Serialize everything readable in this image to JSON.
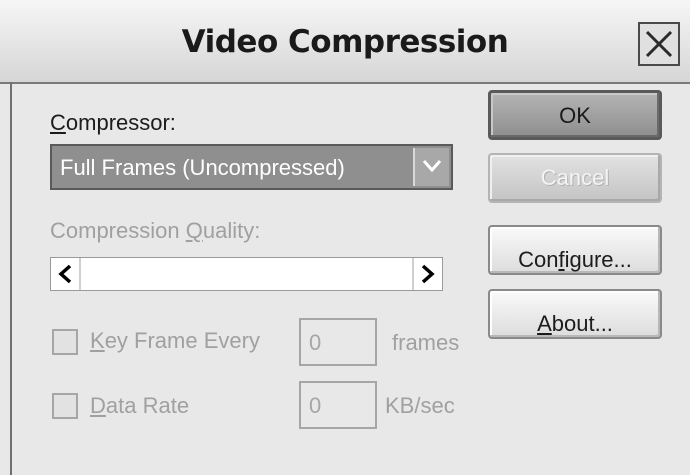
{
  "window": {
    "title": "Video Compression",
    "close_icon": "close-icon"
  },
  "compressor": {
    "label_underlined": "C",
    "label_rest": "ompressor:",
    "selected_value": "Full Frames (Uncompressed)",
    "arrow_icon": "chevron-down-icon"
  },
  "quality": {
    "label_pre": "Compression ",
    "label_underlined": "Q",
    "label_rest": "uality:",
    "left_icon": "chevron-left-icon",
    "right_icon": "chevron-right-icon"
  },
  "key_frame": {
    "label_underlined": "K",
    "label_rest": "ey Frame Every",
    "value": "0",
    "unit": "frames",
    "checked": false
  },
  "data_rate": {
    "label_underlined": "D",
    "label_rest": "ata Rate",
    "value": "0",
    "unit": "KB/sec",
    "checked": false
  },
  "buttons": {
    "ok": "OK",
    "cancel": "Cancel",
    "configure_pre": "Con",
    "configure_underlined": "f",
    "configure_post": "i",
    "configure_underlined2": "g",
    "configure_rest": "ure...",
    "about_underlined": "A",
    "about_rest": "bout..."
  }
}
